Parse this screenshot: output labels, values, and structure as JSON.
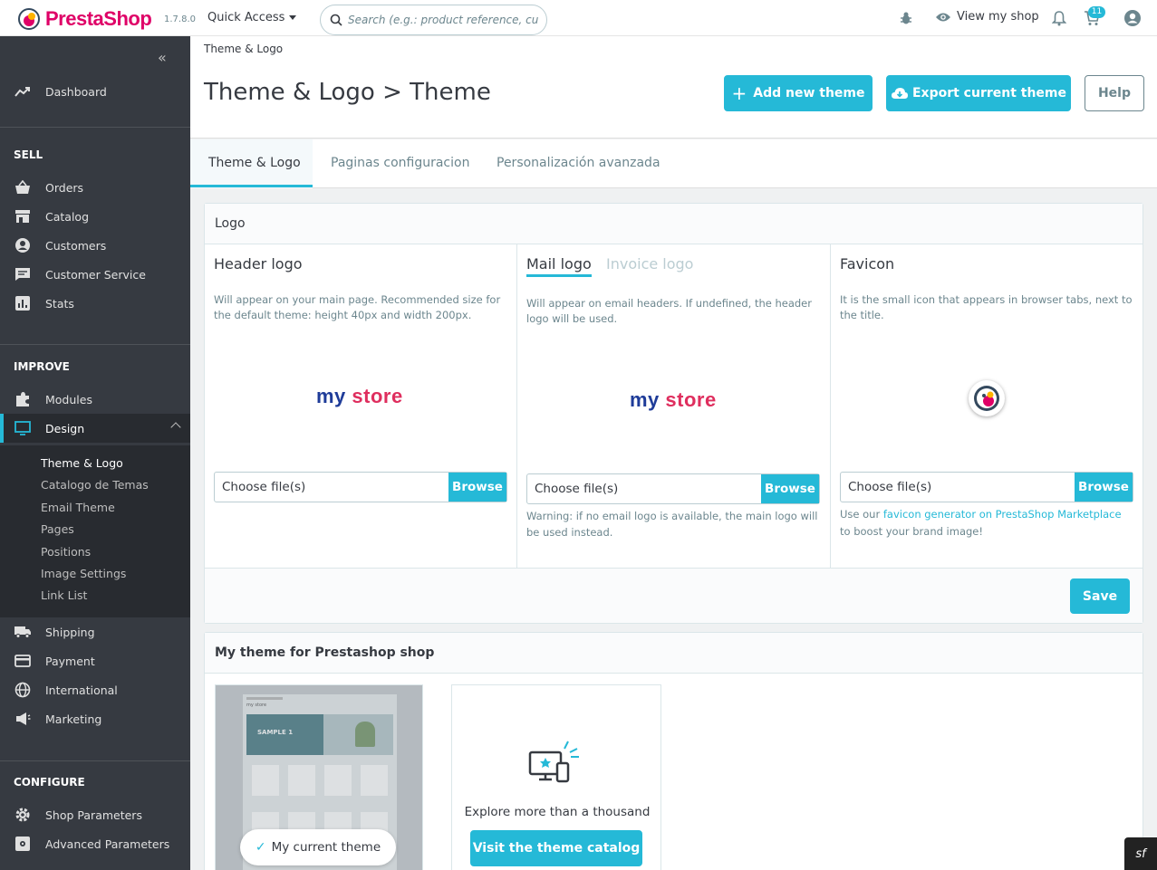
{
  "header": {
    "brand": "PrestaShop",
    "version": "1.7.8.0",
    "quick_access": "Quick Access",
    "search_placeholder": "Search (e.g.: product reference, custon",
    "view_shop": "View my shop",
    "cart_badge": "11",
    "icons": [
      "bug-icon",
      "eye-icon",
      "bell-icon",
      "cart-icon",
      "user-icon"
    ]
  },
  "sidebar": {
    "dashboard": "Dashboard",
    "sell_title": "SELL",
    "sell_items": [
      "Orders",
      "Catalog",
      "Customers",
      "Customer Service",
      "Stats"
    ],
    "improve_title": "IMPROVE",
    "improve_items": [
      "Modules",
      "Design"
    ],
    "design_subitems": [
      "Theme & Logo",
      "Catalogo de Temas",
      "Email Theme",
      "Pages",
      "Positions",
      "Image Settings",
      "Link List"
    ],
    "more_items": [
      "Shipping",
      "Payment",
      "International",
      "Marketing"
    ],
    "configure_title": "CONFIGURE",
    "configure_items": [
      "Shop Parameters",
      "Advanced Parameters"
    ]
  },
  "page": {
    "breadcrumb": "Theme & Logo",
    "title": "Theme & Logo > Theme",
    "add_theme": "Add new theme",
    "export_theme": "Export current theme",
    "help": "Help"
  },
  "tabs": [
    "Theme & Logo",
    "Paginas configuracion",
    "Personalización avanzada"
  ],
  "logo_card": {
    "title": "Logo",
    "header_logo": {
      "title": "Header logo",
      "desc": "Will appear on your main page. Recommended size for the default theme: height 40px and width 200px.",
      "store_a": "my",
      "store_b": "store"
    },
    "mail_logo": {
      "tab_mail": "Mail logo",
      "tab_invoice": "Invoice logo",
      "desc": "Will appear on email headers. If undefined, the header logo will be used.",
      "warning": "Warning: if no email logo is available, the main logo will be used instead."
    },
    "favicon": {
      "title": "Favicon",
      "desc": "It is the small icon that appears in browser tabs, next to the title.",
      "note_pre": "Use our ",
      "note_link": "favicon generator on PrestaShop Marketplace",
      "note_post": " to boost your brand image!"
    },
    "choose_file": "Choose file(s)",
    "browse": "Browse",
    "save": "Save"
  },
  "theme_card": {
    "title": "My theme for Prestashop shop",
    "current_theme": "My current theme",
    "thumb_banner": "SAMPLE 1",
    "thumb_store": "my store",
    "explore": "Explore more than a thousand themes",
    "visit_catalog": "Visit the theme catalog"
  },
  "colors": {
    "accent": "#25b9d7",
    "brand": "#df0067",
    "sidebar": "#363a41"
  },
  "symfony_badge": "sf"
}
